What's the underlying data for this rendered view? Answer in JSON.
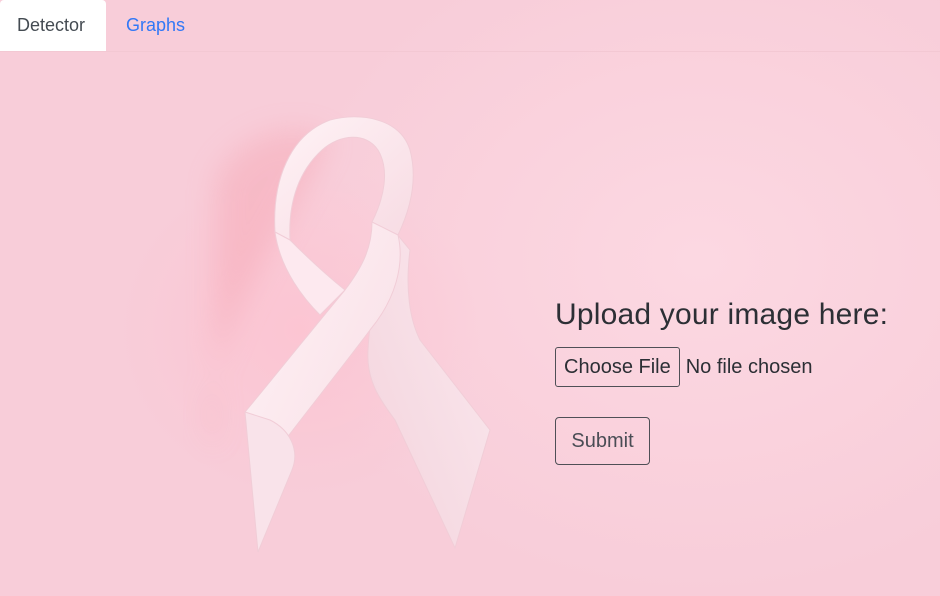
{
  "nav": {
    "tabs": [
      {
        "label": "Detector",
        "active": true
      },
      {
        "label": "Graphs",
        "active": false
      }
    ]
  },
  "upload": {
    "title": "Upload your image here:",
    "choose_file_label": "Choose File",
    "file_status": "No file chosen",
    "submit_label": "Submit"
  },
  "colors": {
    "background": "#f9d1dc",
    "ribbon": "#fbe7ee",
    "link": "#3278f6",
    "text": "#2c2f35"
  },
  "background_image": {
    "icon": "pink-awareness-ribbon"
  }
}
